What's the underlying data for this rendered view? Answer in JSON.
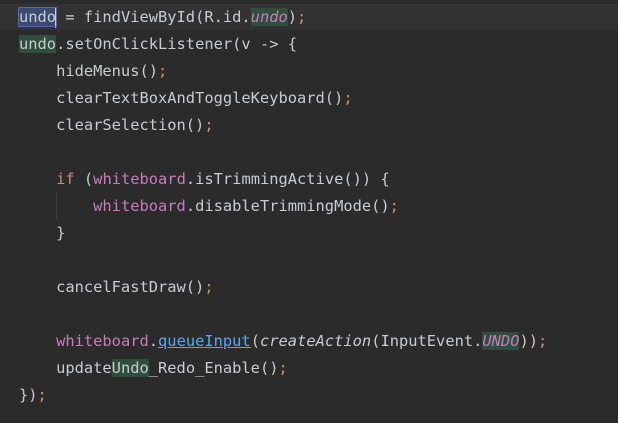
{
  "editor": {
    "lines": [
      {
        "parts": [
          {
            "text": "undo",
            "style": "sel-blue"
          },
          {
            "text": " = findViewById(R.id."
          },
          {
            "text": "undo",
            "style": "sel-green italic field"
          },
          {
            "text": ")"
          },
          {
            "text": ";",
            "style": "punct-semi"
          }
        ]
      },
      {
        "parts": [
          {
            "text": "undo",
            "style": "sel-green"
          },
          {
            "text": ".setOnClickListener(v -> {"
          }
        ]
      },
      {
        "parts": [
          {
            "text": "    hideMenus()"
          },
          {
            "text": ";",
            "style": "punct-semi"
          }
        ]
      },
      {
        "parts": [
          {
            "text": "    clearTextBoxAndToggleKeyboard()"
          },
          {
            "text": ";",
            "style": "punct-semi"
          }
        ]
      },
      {
        "parts": [
          {
            "text": "    clearSelection()"
          },
          {
            "text": ";",
            "style": "punct-semi"
          }
        ]
      },
      {
        "parts": [
          {
            "text": ""
          }
        ]
      },
      {
        "parts": [
          {
            "text": "    "
          },
          {
            "text": "if",
            "style": "keyword"
          },
          {
            "text": " ("
          },
          {
            "text": "whiteboard",
            "style": "field"
          },
          {
            "text": ".isTrimmingActive()) {"
          }
        ]
      },
      {
        "parts": [
          {
            "text": "        "
          },
          {
            "text": "whiteboard",
            "style": "field"
          },
          {
            "text": ".disableTrimmingMode()"
          },
          {
            "text": ";",
            "style": "punct-semi"
          }
        ]
      },
      {
        "parts": [
          {
            "text": "    }"
          }
        ]
      },
      {
        "parts": [
          {
            "text": ""
          }
        ]
      },
      {
        "parts": [
          {
            "text": "    cancelFastDraw()"
          },
          {
            "text": ";",
            "style": "punct-semi"
          }
        ]
      },
      {
        "parts": [
          {
            "text": ""
          }
        ]
      },
      {
        "parts": [
          {
            "text": "    "
          },
          {
            "text": "whiteboard",
            "style": "field"
          },
          {
            "text": "."
          },
          {
            "text": "queueInput",
            "style": "method-call"
          },
          {
            "text": "("
          },
          {
            "text": "createAction",
            "style": "italic"
          },
          {
            "text": "(InputEvent."
          },
          {
            "text": "UNDO",
            "style": "sel-green italic field"
          },
          {
            "text": "))"
          },
          {
            "text": ";",
            "style": "punct-semi"
          }
        ]
      },
      {
        "parts": [
          {
            "text": "    update"
          },
          {
            "text": "Undo",
            "style": "sel-green"
          },
          {
            "text": "_Redo_Enable()"
          },
          {
            "text": ";",
            "style": "punct-semi"
          }
        ]
      },
      {
        "parts": [
          {
            "text": "})"
          },
          {
            "text": ";",
            "style": "punct-semi"
          }
        ]
      }
    ]
  }
}
